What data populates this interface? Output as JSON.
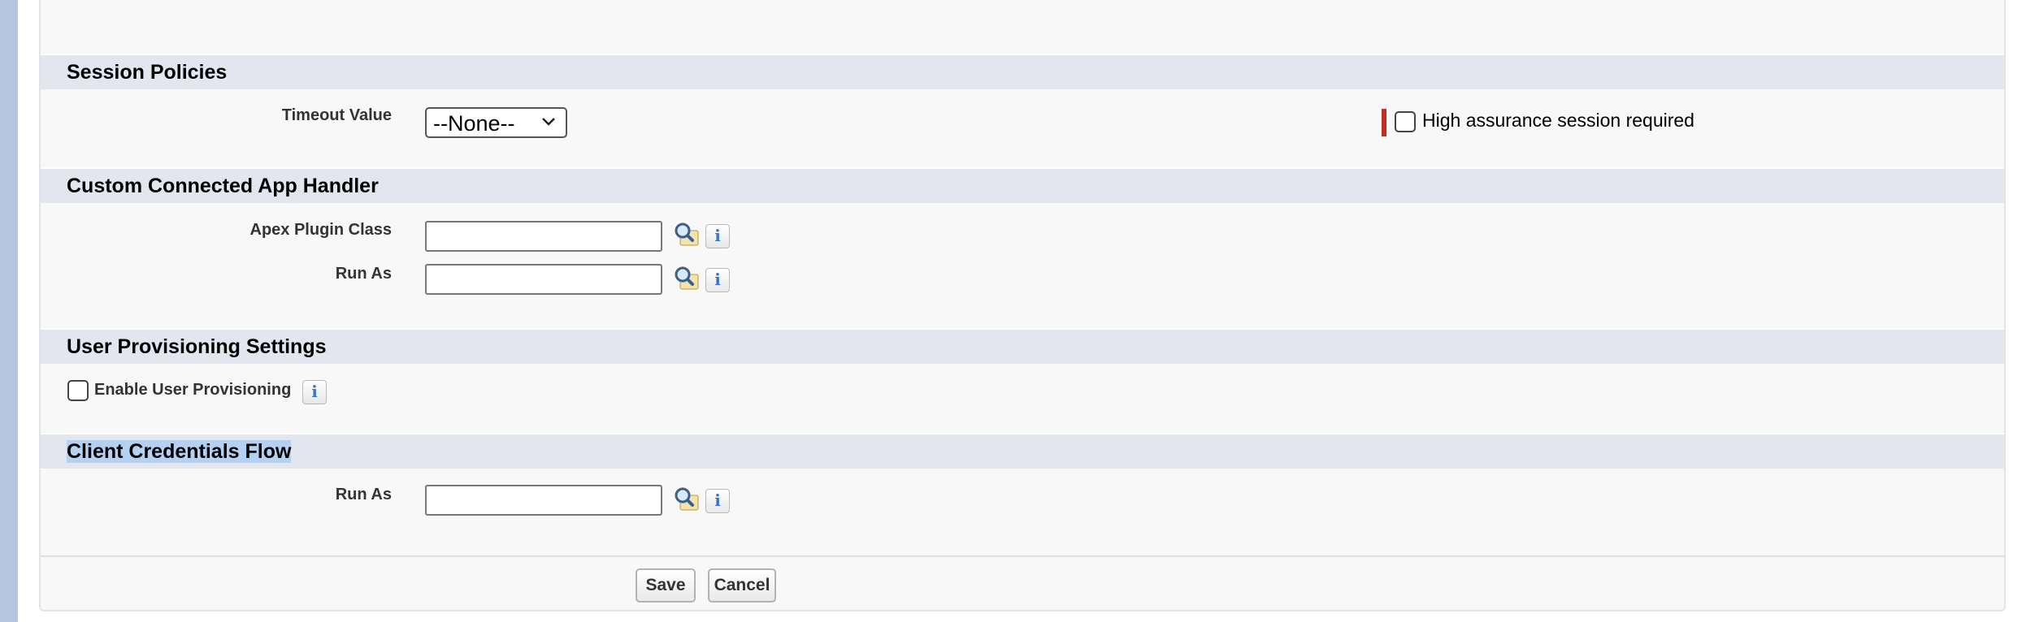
{
  "sections": {
    "session_policies": {
      "title": "Session Policies",
      "timeout_label": "Timeout Value",
      "timeout_selected": "--None--",
      "high_assurance_label": "High assurance session required"
    },
    "custom_handler": {
      "title": "Custom Connected App Handler",
      "apex_plugin_label": "Apex Plugin Class",
      "run_as_label": "Run As"
    },
    "user_provisioning": {
      "title": "User Provisioning Settings",
      "enable_label": "Enable User Provisioning"
    },
    "client_credentials": {
      "title": "Client Credentials Flow",
      "run_as_label": "Run As"
    }
  },
  "info_glyph": "i",
  "buttons": {
    "save": "Save",
    "cancel": "Cancel"
  },
  "colors": {
    "section_bar": "#e3e6ee",
    "panel_bg": "#f8f8f8",
    "required": "#c0301f",
    "selection": "#b4d1f1",
    "left_rail": "#b6c6e1"
  },
  "icons": {
    "lookup": "lookup-magnifier-icon",
    "info": "info-icon",
    "dropdown": "chevron-down-icon"
  }
}
